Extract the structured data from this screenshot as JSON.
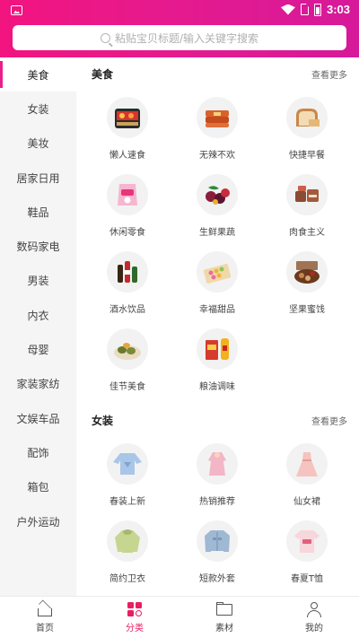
{
  "status_bar": {
    "time": "3:03"
  },
  "search": {
    "placeholder": "粘贴宝贝标题/输入关键字搜索"
  },
  "sidebar": {
    "items": [
      {
        "label": "美食",
        "active": true
      },
      {
        "label": "女装"
      },
      {
        "label": "美妆"
      },
      {
        "label": "居家日用"
      },
      {
        "label": "鞋品"
      },
      {
        "label": "数码家电"
      },
      {
        "label": "男装"
      },
      {
        "label": "内衣"
      },
      {
        "label": "母婴"
      },
      {
        "label": "家装家纺"
      },
      {
        "label": "文娱车品"
      },
      {
        "label": "配饰"
      },
      {
        "label": "箱包"
      },
      {
        "label": "户外运动"
      }
    ]
  },
  "sections": [
    {
      "title": "美食",
      "more": "查看更多",
      "items": [
        {
          "label": "懒人速食",
          "icon": "instant-food-icon"
        },
        {
          "label": "无辣不欢",
          "icon": "spicy-snack-icon"
        },
        {
          "label": "快捷早餐",
          "icon": "bread-icon"
        },
        {
          "label": "休闲零食",
          "icon": "snack-bag-icon"
        },
        {
          "label": "生鲜果蔬",
          "icon": "fruit-icon"
        },
        {
          "label": "肉食主义",
          "icon": "meat-icon"
        },
        {
          "label": "酒水饮品",
          "icon": "drinks-icon"
        },
        {
          "label": "幸福甜品",
          "icon": "dessert-icon"
        },
        {
          "label": "坚果蜜饯",
          "icon": "nuts-icon"
        },
        {
          "label": "佳节美食",
          "icon": "festival-food-icon"
        },
        {
          "label": "粮油调味",
          "icon": "oil-icon"
        }
      ]
    },
    {
      "title": "女装",
      "more": "查看更多",
      "items": [
        {
          "label": "春装上新",
          "icon": "blouse-icon"
        },
        {
          "label": "热销推荐",
          "icon": "pink-top-icon"
        },
        {
          "label": "仙女裙",
          "icon": "dress-icon"
        },
        {
          "label": "简约卫衣",
          "icon": "hoodie-icon"
        },
        {
          "label": "短款外套",
          "icon": "denim-jacket-icon"
        },
        {
          "label": "春夏T恤",
          "icon": "tshirt-icon"
        }
      ]
    }
  ],
  "tabbar": {
    "tabs": [
      {
        "label": "首页",
        "icon": "home-icon"
      },
      {
        "label": "分类",
        "icon": "category-icon",
        "active": true
      },
      {
        "label": "素材",
        "icon": "folder-icon"
      },
      {
        "label": "我的",
        "icon": "user-icon"
      }
    ]
  },
  "colors": {
    "accent": "#e91e63",
    "header_gradient_start": "#f2147f",
    "header_gradient_end": "#d6199a",
    "sidebar_bg": "#f5f5f5"
  }
}
